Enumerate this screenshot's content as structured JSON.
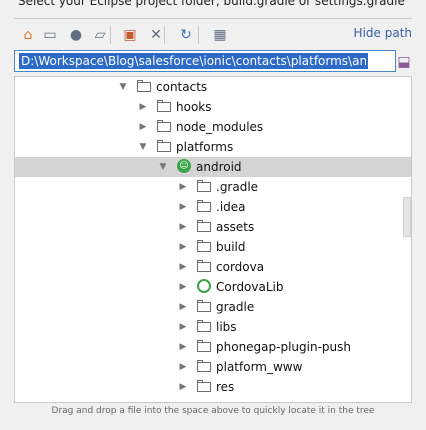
{
  "prompt": "Select your Eclipse project folder, build.gradle or settings.gradle",
  "toolbar": {
    "buttons": [
      {
        "name": "home-icon",
        "glyph": "⌂"
      },
      {
        "name": "desktop-icon",
        "glyph": "▭"
      },
      {
        "name": "comment-icon",
        "glyph": "●"
      },
      {
        "name": "folder-icon",
        "glyph": "▱"
      },
      {
        "name": "new-folder-icon",
        "glyph": "▣"
      },
      {
        "name": "delete-icon",
        "glyph": "✕"
      },
      {
        "name": "refresh-icon",
        "glyph": "↻"
      },
      {
        "name": "show-hidden-icon",
        "glyph": "▦"
      }
    ],
    "hide_path_label": "Hide path"
  },
  "path": {
    "value": "D:\\Workspace\\Blog\\salesforce\\ionic\\contacts\\platforms\\android"
  },
  "tree": {
    "items": [
      {
        "label": "contacts",
        "depth": 0,
        "expanded": true,
        "icon": "folder"
      },
      {
        "label": "hooks",
        "depth": 1,
        "expanded": false,
        "icon": "folder"
      },
      {
        "label": "node_modules",
        "depth": 1,
        "expanded": false,
        "icon": "folder"
      },
      {
        "label": "platforms",
        "depth": 1,
        "expanded": true,
        "icon": "folder"
      },
      {
        "label": "android",
        "depth": 2,
        "expanded": true,
        "icon": "android",
        "selected": true
      },
      {
        "label": ".gradle",
        "depth": 3,
        "expanded": false,
        "icon": "folder"
      },
      {
        "label": ".idea",
        "depth": 3,
        "expanded": false,
        "icon": "folder"
      },
      {
        "label": "assets",
        "depth": 3,
        "expanded": false,
        "icon": "folder"
      },
      {
        "label": "build",
        "depth": 3,
        "expanded": false,
        "icon": "folder"
      },
      {
        "label": "cordova",
        "depth": 3,
        "expanded": false,
        "icon": "folder"
      },
      {
        "label": "CordovaLib",
        "depth": 3,
        "expanded": false,
        "icon": "module"
      },
      {
        "label": "gradle",
        "depth": 3,
        "expanded": false,
        "icon": "folder"
      },
      {
        "label": "libs",
        "depth": 3,
        "expanded": false,
        "icon": "folder"
      },
      {
        "label": "phonegap-plugin-push",
        "depth": 3,
        "expanded": false,
        "icon": "folder"
      },
      {
        "label": "platform_www",
        "depth": 3,
        "expanded": false,
        "icon": "folder"
      },
      {
        "label": "res",
        "depth": 3,
        "expanded": false,
        "icon": "folder"
      }
    ]
  },
  "hint": "Drag and drop a file into the space above to quickly locate it in the tree"
}
